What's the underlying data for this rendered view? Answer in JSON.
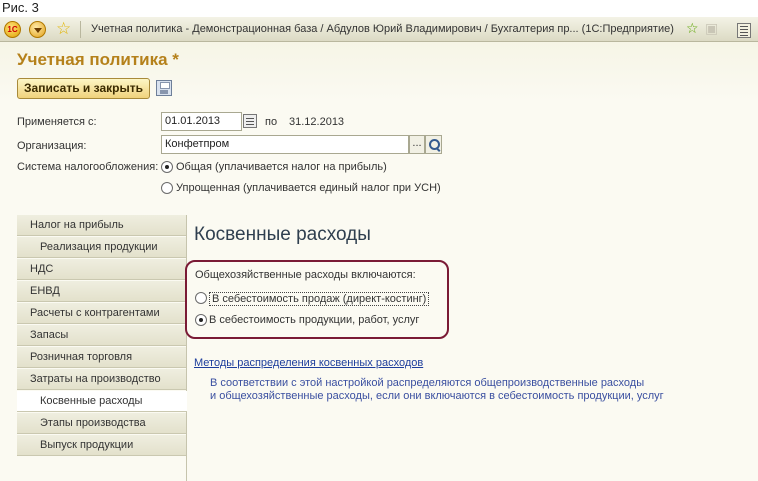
{
  "figure_label": "Рис. 3",
  "titlebar": {
    "title": "Учетная политика - Демонстрационная база / Абдулов Юрий Владимирович / Бухгалтерия пр...  (1С:Предприятие)"
  },
  "form": {
    "title": "Учетная политика *",
    "save_close_label": "Записать и закрыть",
    "applies_from_label": "Применяется с:",
    "date_from": "01.01.2013",
    "to_label": "по",
    "date_to": "31.12.2013",
    "org_label": "Организация:",
    "org_value": "Конфетпром",
    "dots_label": "...",
    "tax_label": "Система налогообложения:",
    "tax_options": [
      {
        "label": "Общая (уплачивается налог на прибыль)",
        "selected": true
      },
      {
        "label": "Упрощенная (уплачивается единый налог при УСН)",
        "selected": false
      }
    ]
  },
  "sidebar": {
    "items": [
      {
        "label": "Налог на прибыль",
        "sub": false,
        "active": false
      },
      {
        "label": "Реализация продукции",
        "sub": true,
        "active": false
      },
      {
        "label": "НДС",
        "sub": false,
        "active": false
      },
      {
        "label": "ЕНВД",
        "sub": false,
        "active": false
      },
      {
        "label": "Расчеты с контрагентами",
        "sub": false,
        "active": false
      },
      {
        "label": "Запасы",
        "sub": false,
        "active": false
      },
      {
        "label": "Розничная торговля",
        "sub": false,
        "active": false
      },
      {
        "label": "Затраты на производство",
        "sub": false,
        "active": false
      },
      {
        "label": "Косвенные расходы",
        "sub": true,
        "active": true
      },
      {
        "label": "Этапы производства",
        "sub": true,
        "active": false
      },
      {
        "label": "Выпуск продукции",
        "sub": true,
        "active": false
      }
    ]
  },
  "main": {
    "section_title": "Косвенные расходы",
    "group_label": "Общехозяйственные расходы включаются:",
    "options": [
      {
        "label": "В себестоимость продаж (директ-костинг)",
        "selected": false
      },
      {
        "label": "В себестоимость продукции, работ, услуг",
        "selected": true
      }
    ],
    "link": "Методы распределения косвенных расходов",
    "note_line1": "В соответствии с этой настройкой распределяются общепроизводственные расходы",
    "note_line2": "и общехозяйственные расходы, если они включаются в себестоимость продукции, услуг"
  },
  "colors": {
    "title_accent": "#b5811b",
    "highlight_frame": "#7a1a35",
    "link": "#1d3d9c"
  }
}
